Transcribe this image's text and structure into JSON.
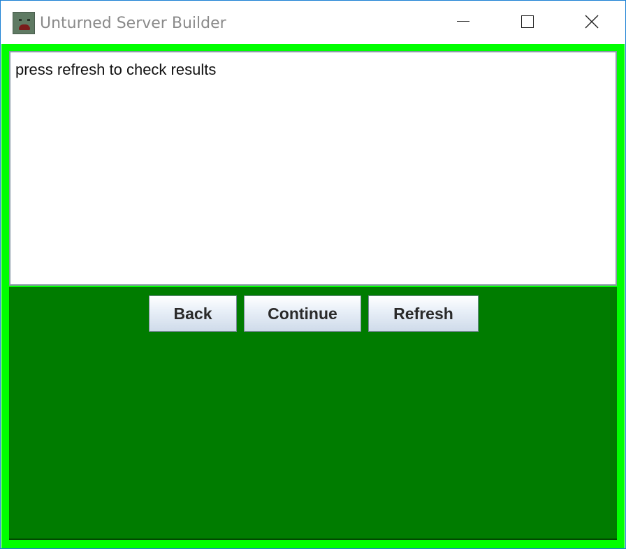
{
  "window": {
    "title": "Unturned Server Builder",
    "icon": "unturned-zombie-icon"
  },
  "controls": {
    "minimize_icon": "minimize-icon",
    "maximize_icon": "maximize-icon",
    "close_icon": "close-icon"
  },
  "output": {
    "text": "press refresh to check results"
  },
  "buttons": {
    "back_label": "Back",
    "continue_label": "Continue",
    "refresh_label": "Refresh"
  },
  "colors": {
    "outer_border": "#00ff00",
    "panel_background": "#007c00",
    "window_frame": "#1a7fd4"
  }
}
